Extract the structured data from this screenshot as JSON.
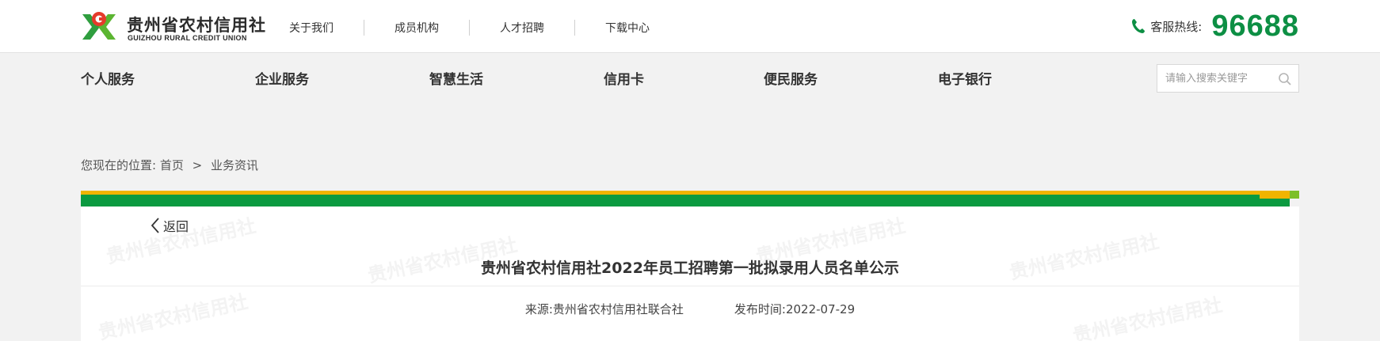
{
  "header": {
    "logo_cn": "贵州省农村信用社",
    "logo_en": "GUIZHOU RURAL CREDIT UNION",
    "top_links": [
      "关于我们",
      "成员机构",
      "人才招聘",
      "下载中心"
    ],
    "hotline_label": "客服热线:",
    "hotline_number": "96688"
  },
  "nav": {
    "items": [
      "个人服务",
      "企业服务",
      "智慧生活",
      "信用卡",
      "便民服务",
      "电子银行"
    ]
  },
  "search": {
    "placeholder": "请输入搜索关键字"
  },
  "breadcrumb": {
    "prefix": "您现在的位置:",
    "home": "首页",
    "separator": ">",
    "current": "业务资讯"
  },
  "article": {
    "back_label": "返回",
    "title": "贵州省农村信用社2022年员工招聘第一批拟录用人员名单公示",
    "source_label": "来源:",
    "source": "贵州省农村信用社联合社",
    "date_label": "发布时间:",
    "date": "2022-07-29",
    "watermark_text": "贵州省农村信用社"
  },
  "colors": {
    "brand_green": "#0b9a40",
    "accent_yellow": "#f0b400",
    "hotline_green": "#0d8f44"
  }
}
